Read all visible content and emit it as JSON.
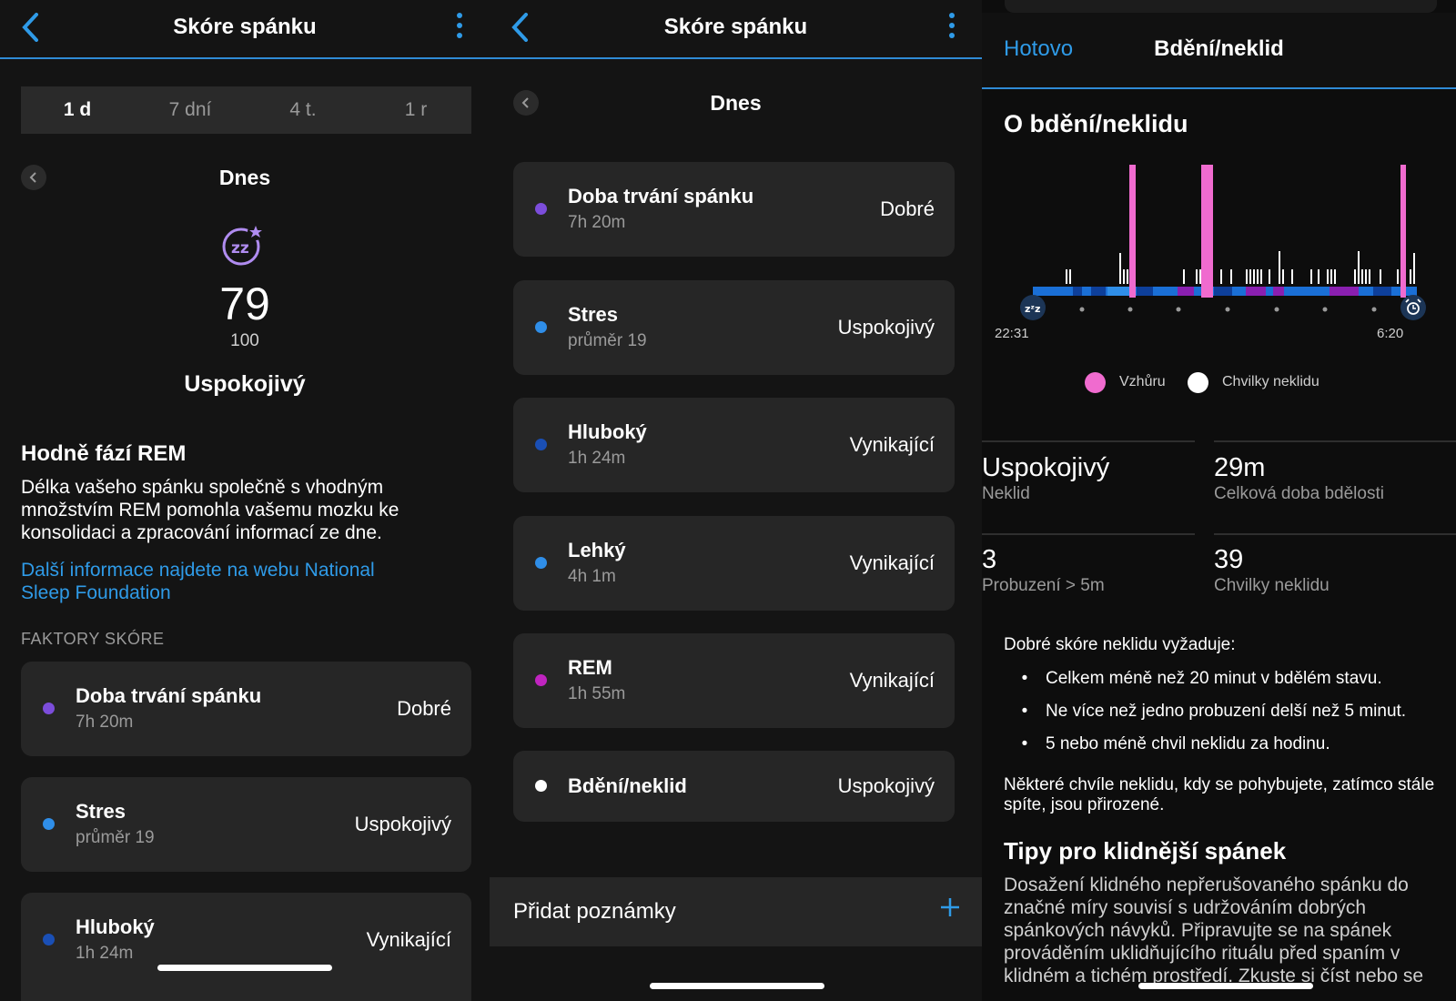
{
  "panel1": {
    "header": {
      "title": "Skóre spánku"
    },
    "segments": [
      "1 d",
      "7 dní",
      "4 t.",
      "1 r"
    ],
    "active_segment": "1 d",
    "date_label": "Dnes",
    "score": {
      "value": "79",
      "max": "100",
      "rating": "Uspokojivý"
    },
    "insight": {
      "title": "Hodně fází REM",
      "body_lines": [
        "Délka vašeho spánku společně s vhodným",
        "množstvím REM pomohla vašemu mozku ke",
        "konsolidaci a zpracování informací ze dne."
      ],
      "link_lines": [
        "Další informace najdete na webu National",
        "Sleep Foundation"
      ]
    },
    "factors_label": "FAKTORY SKÓRE",
    "factors": [
      {
        "name": "Doba trvání spánku",
        "sub": "7h 20m",
        "value": "Dobré",
        "color": "#7c4ddb"
      },
      {
        "name": "Stres",
        "sub": "průměr 19",
        "value": "Uspokojivý",
        "color": "#2f8ee8"
      },
      {
        "name": "Hluboký",
        "sub": "1h 24m",
        "value": "Vynikající",
        "color": "#1a4fb5"
      }
    ]
  },
  "panel2": {
    "header": {
      "title": "Skóre spánku"
    },
    "date_label": "Dnes",
    "factors": [
      {
        "name": "Doba trvání spánku",
        "sub": "7h 20m",
        "value": "Dobré",
        "color": "#7c4ddb"
      },
      {
        "name": "Stres",
        "sub": "průměr 19",
        "value": "Uspokojivý",
        "color": "#2f8ee8"
      },
      {
        "name": "Hluboký",
        "sub": "1h 24m",
        "value": "Vynikající",
        "color": "#1a4fb5"
      },
      {
        "name": "Lehký",
        "sub": "4h 1m",
        "value": "Vynikající",
        "color": "#2f8ee8"
      },
      {
        "name": "REM",
        "sub": "1h 55m",
        "value": "Vynikající",
        "color": "#c024c0"
      },
      {
        "name": "Bdění/neklid",
        "sub": "",
        "value": "Uspokojivý",
        "color": "#ffffff"
      }
    ],
    "add_notes": "Přidat poznámky"
  },
  "panel3": {
    "done": "Hotovo",
    "title": "Bdění/neklid",
    "section_title": "O bdění/neklidu",
    "chart": {
      "start_time": "22:31",
      "end_time": "6:20",
      "legend_awake": "Vzhůru",
      "legend_restless": "Chvilky neklidu"
    },
    "stats": [
      {
        "value": "Uspokojivý",
        "label": "Neklid"
      },
      {
        "value": "29m",
        "label": "Celková doba bdělosti"
      },
      {
        "value": "3",
        "label": "Probuzení > 5m"
      },
      {
        "value": "39",
        "label": "Chvilky neklidu"
      }
    ],
    "requirement_intro": "Dobré skóre neklidu vyžaduje:",
    "requirements": [
      "Celkem méně než 20 minut v bdělém stavu.",
      "Ne více než jedno probuzení delší než 5 minut.",
      "5 nebo méně chvil neklidu za hodinu."
    ],
    "note_lines": [
      "Některé chvíle neklidu, kdy se pohybujete, zatímco stále",
      "spíte, jsou přirozené."
    ],
    "tips_title": "Tipy pro klidnější spánek",
    "tips_lines": [
      "Dosažení klidného nepřerušovaného spánku do",
      "značné míry souvisí s udržováním dobrých",
      "spánkových návyků. Připravujte se na spánek",
      "prováděním uklidňujícího rituálu před spaním v",
      "klidném a tichém prostředí. Zkuste si číst nebo se"
    ],
    "colors": {
      "accent": "#2f9be8",
      "awake": "#f06bcf",
      "restless": "#ffffff"
    }
  }
}
